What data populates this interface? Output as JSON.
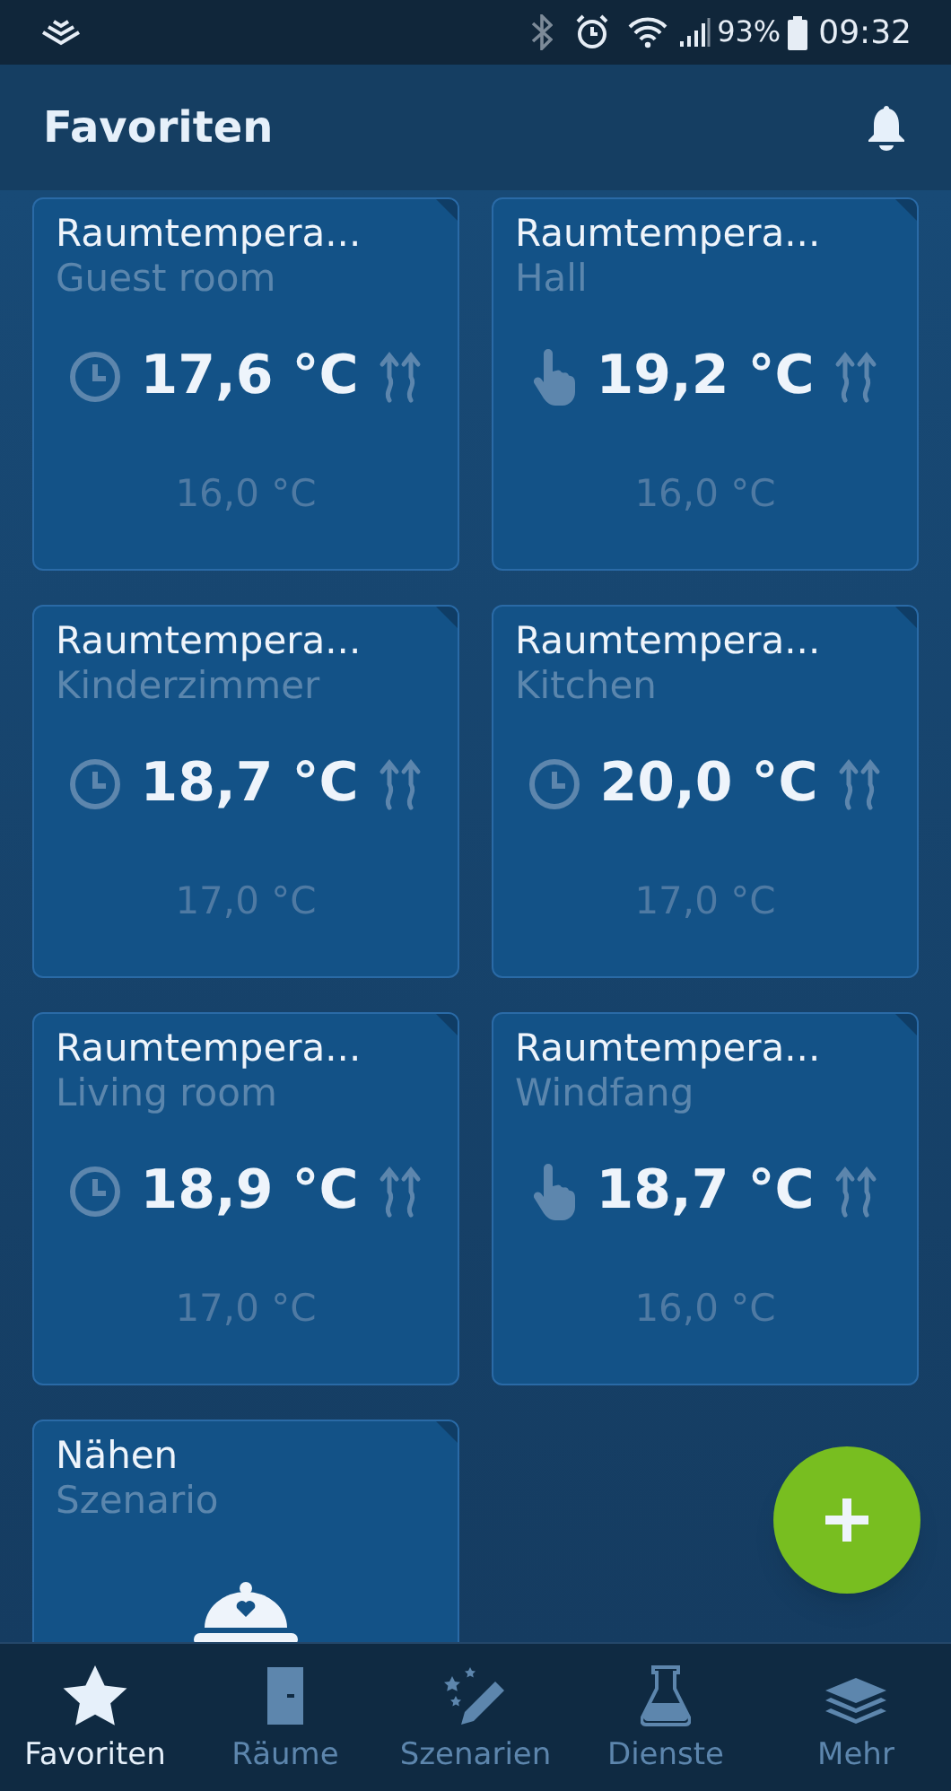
{
  "status_bar": {
    "battery": "93%",
    "time": "09:32"
  },
  "header": {
    "title": "Favoriten"
  },
  "tiles": [
    {
      "kind": "thermostat",
      "title": "Raumtempera...",
      "room": "Guest room",
      "manual": false,
      "temperature": "17,6 °C",
      "setpoint": "16,0 °C"
    },
    {
      "kind": "thermostat",
      "title": "Raumtempera...",
      "room": "Hall",
      "manual": true,
      "temperature": "19,2 °C",
      "setpoint": "16,0 °C"
    },
    {
      "kind": "thermostat",
      "title": "Raumtempera...",
      "room": "Kinderzimmer",
      "manual": false,
      "temperature": "18,7 °C",
      "setpoint": "17,0 °C"
    },
    {
      "kind": "thermostat",
      "title": "Raumtempera...",
      "room": "Kitchen",
      "manual": false,
      "temperature": "20,0 °C",
      "setpoint": "17,0 °C"
    },
    {
      "kind": "thermostat",
      "title": "Raumtempera...",
      "room": "Living room",
      "manual": false,
      "temperature": "18,9 °C",
      "setpoint": "17,0 °C"
    },
    {
      "kind": "thermostat",
      "title": "Raumtempera...",
      "room": "Windfang",
      "manual": true,
      "temperature": "18,7 °C",
      "setpoint": "16,0 °C"
    },
    {
      "kind": "scenario",
      "title": "Nähen",
      "room": "Szenario"
    }
  ],
  "nav": [
    {
      "kind": "star",
      "label": "Favoriten",
      "selected": true
    },
    {
      "kind": "door",
      "label": "Räume",
      "selected": false
    },
    {
      "kind": "wand",
      "label": "Szenarien",
      "selected": false
    },
    {
      "kind": "flask",
      "label": "Dienste",
      "selected": false
    },
    {
      "kind": "layers",
      "label": "Mehr",
      "selected": false
    }
  ]
}
